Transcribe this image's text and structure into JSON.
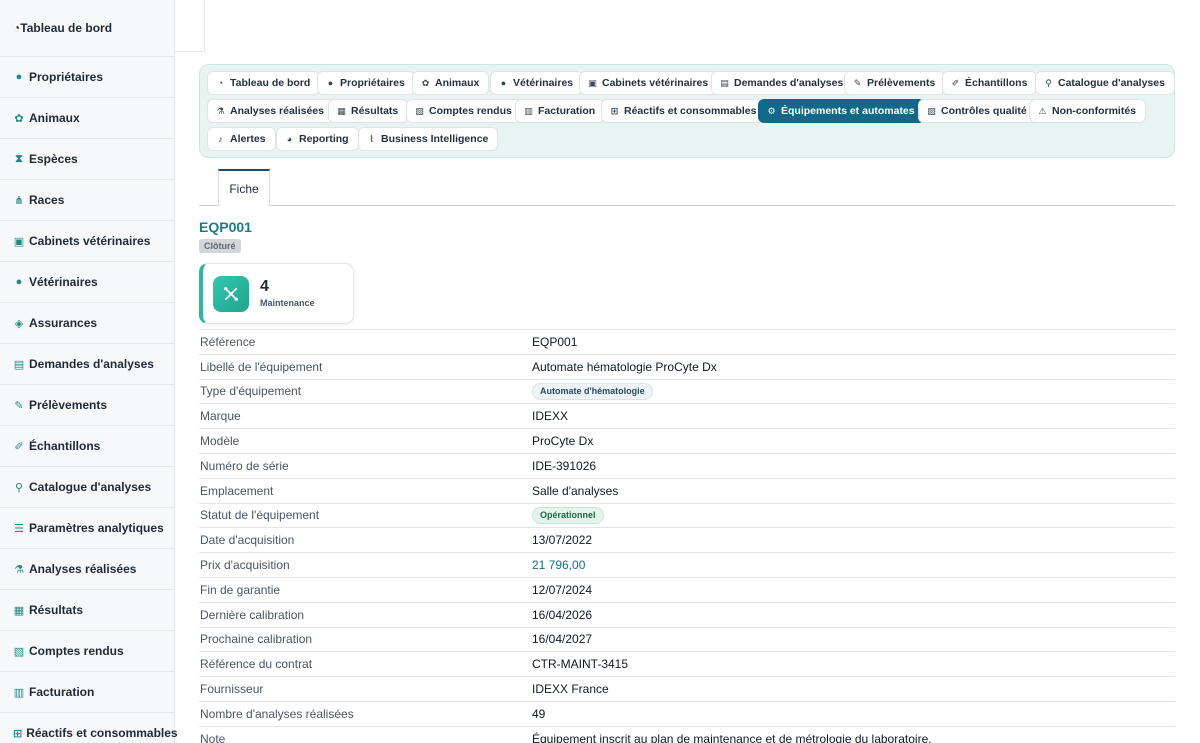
{
  "sidebar": {
    "items": [
      {
        "label": "Tableau de bord",
        "icon": "dashboard-icon"
      },
      {
        "label": "Propriétaires",
        "icon": "user-icon"
      },
      {
        "label": "Animaux",
        "icon": "paw-icon"
      },
      {
        "label": "Espèces",
        "icon": "hourglass-icon"
      },
      {
        "label": "Races",
        "icon": "sitemap-icon"
      },
      {
        "label": "Cabinets vétérinaires",
        "icon": "clinic-icon"
      },
      {
        "label": "Vétérinaires",
        "icon": "user-doctor-icon"
      },
      {
        "label": "Assurances",
        "icon": "shield-icon"
      },
      {
        "label": "Demandes d'analyses",
        "icon": "file-medical-icon"
      },
      {
        "label": "Prélèvements",
        "icon": "syringe-icon"
      },
      {
        "label": "Échantillons",
        "icon": "vial-icon"
      },
      {
        "label": "Catalogue d'analyses",
        "icon": "microscope-icon"
      },
      {
        "label": "Paramètres analytiques",
        "icon": "list-icon"
      },
      {
        "label": "Analyses réalisées",
        "icon": "flask-icon"
      },
      {
        "label": "Résultats",
        "icon": "notes-medical-icon"
      },
      {
        "label": "Comptes rendus",
        "icon": "file-signature-icon"
      },
      {
        "label": "Facturation",
        "icon": "invoice-icon"
      },
      {
        "label": "Réactifs et consommables",
        "icon": "boxes-icon"
      }
    ]
  },
  "nav": {
    "pills": [
      {
        "label": "Tableau de bord",
        "icon": "dashboard-icon"
      },
      {
        "label": "Propriétaires",
        "icon": "user-icon"
      },
      {
        "label": "Animaux",
        "icon": "paw-icon"
      },
      {
        "label": "Vétérinaires",
        "icon": "user-doctor-icon"
      },
      {
        "label": "Cabinets vétérinaires",
        "icon": "clinic-icon"
      },
      {
        "label": "Demandes d'analyses",
        "icon": "file-medical-icon"
      },
      {
        "label": "Prélèvements",
        "icon": "syringe-icon"
      },
      {
        "label": "Échantillons",
        "icon": "vial-icon"
      },
      {
        "label": "Catalogue d'analyses",
        "icon": "microscope-icon"
      },
      {
        "label": "Analyses réalisées",
        "icon": "flask-icon"
      },
      {
        "label": "Résultats",
        "icon": "notes-medical-icon"
      },
      {
        "label": "Comptes rendus",
        "icon": "file-signature-icon"
      },
      {
        "label": "Facturation",
        "icon": "invoice-icon"
      },
      {
        "label": "Réactifs et consommables",
        "icon": "boxes-icon"
      },
      {
        "label": "Équipements et automates",
        "icon": "cogs-icon",
        "active": true
      },
      {
        "label": "Contrôles qualité",
        "icon": "clipboard-check-icon"
      },
      {
        "label": "Non-conformités",
        "icon": "warning-icon"
      },
      {
        "label": "Alertes",
        "icon": "bell-icon"
      },
      {
        "label": "Reporting",
        "icon": "pie-chart-icon"
      },
      {
        "label": "Business Intelligence",
        "icon": "line-chart-icon"
      }
    ]
  },
  "tabs": {
    "fiche": "Fiche"
  },
  "record": {
    "title": "EQP001",
    "status_badge": "Clôturé",
    "kpi": {
      "value": "4",
      "label": "Maintenance",
      "icon": "tools-icon"
    }
  },
  "details": [
    {
      "key": "Référence",
      "value": "EQP001"
    },
    {
      "key": "Libellé de l'équipement",
      "value": "Automate hématologie ProCyte Dx"
    },
    {
      "key": "Type d'équipement",
      "value": "Automate d'hématologie",
      "chip": "type"
    },
    {
      "key": "Marque",
      "value": "IDEXX"
    },
    {
      "key": "Modèle",
      "value": "ProCyte Dx"
    },
    {
      "key": "Numéro de série",
      "value": "IDE-391026"
    },
    {
      "key": "Emplacement",
      "value": "Salle d'analyses"
    },
    {
      "key": "Statut de l'équipement",
      "value": "Opérationnel",
      "chip": "ok"
    },
    {
      "key": "Date d'acquisition",
      "value": "13/07/2022"
    },
    {
      "key": "Prix d'acquisition",
      "value": "21 796,00",
      "link": true
    },
    {
      "key": "Fin de garantie",
      "value": "12/07/2024"
    },
    {
      "key": "Dernière calibration",
      "value": "16/04/2026"
    },
    {
      "key": "Prochaine calibration",
      "value": "16/04/2027"
    },
    {
      "key": "Référence du contrat",
      "value": "CTR-MAINT-3415"
    },
    {
      "key": "Fournisseur",
      "value": "IDEXX France"
    },
    {
      "key": "Nombre d'analyses réalisées",
      "value": "49"
    },
    {
      "key": "Note",
      "value": "Équipement inscrit au plan de maintenance et de métrologie du laboratoire."
    }
  ],
  "colors": {
    "accent": "#1d8a86",
    "active_pill": "#11698a",
    "kpi_icon": "#2cb89f",
    "title": "#1b7d88"
  }
}
